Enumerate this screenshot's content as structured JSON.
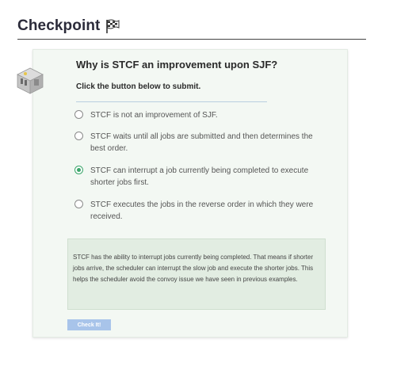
{
  "header": {
    "title": "Checkpoint",
    "icon": "checkered-flag-icon"
  },
  "card": {
    "avatar_icon": "robot-icon",
    "question": "Why is STCF an improvement upon SJF?",
    "instruction": "Click the button below to submit.",
    "options": [
      {
        "label": "STCF is not an improvement of SJF.",
        "selected": false
      },
      {
        "label": "STCF waits until all jobs are submitted and then determines the best order.",
        "selected": false
      },
      {
        "label": "STCF can interrupt a job currently being completed to execute shorter jobs first.",
        "selected": true
      },
      {
        "label": "STCF executes the jobs in the reverse order in which they were received.",
        "selected": false
      }
    ],
    "feedback": "STCF has the ability to interrupt jobs currently being completed. That means if shorter jobs arrive, the scheduler can interrupt the slow job and execute the shorter jobs. This helps the scheduler avoid the convoy issue we have seen in previous examples.",
    "submit_label": "Check It!"
  },
  "colors": {
    "selected": "#3ca66b",
    "button": "#a8c4ea",
    "card_bg": "#f3f8f3",
    "feedback_bg": "#e2ede2"
  }
}
